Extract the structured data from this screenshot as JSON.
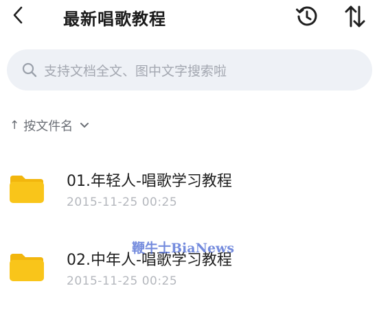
{
  "header": {
    "back_icon": "chevron-left-icon",
    "title": "最新唱歌教程",
    "history_icon": "history-clock-icon",
    "sort_icon": "sort-up-down-icon"
  },
  "search": {
    "icon": "search-icon",
    "placeholder": "支持文档全文、图中文字搜索啦"
  },
  "sort": {
    "arrow": "↑",
    "label": "按文件名",
    "icon": "chevron-down-icon"
  },
  "files": [
    {
      "name": "01.年轻人-唱歌学习教程",
      "date": "2015-11-25 00:25",
      "icon": "folder-icon"
    },
    {
      "name": "02.中年人-唱歌学习教程",
      "date": "2015-11-25 00:25",
      "icon": "folder-icon"
    }
  ],
  "watermark": {
    "text": "鞭牛士BiaNews"
  },
  "colors": {
    "folder_yellow": "#f9c51a",
    "folder_tab": "#f2b60d",
    "search_bg": "#eef1f6",
    "text_primary": "#1e1e1e",
    "text_secondary": "#b4b7bd",
    "watermark": "#4664d2"
  }
}
